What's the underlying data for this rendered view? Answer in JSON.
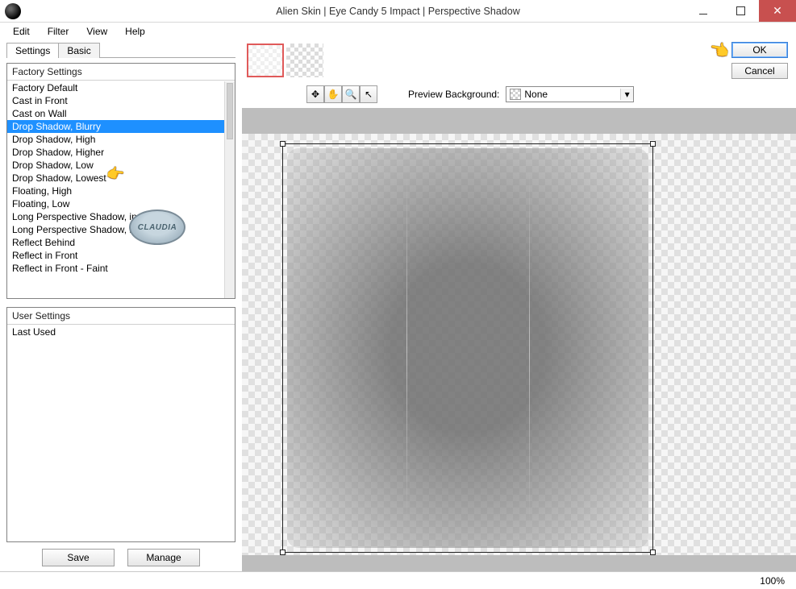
{
  "title": "Alien Skin | Eye Candy 5 Impact | Perspective Shadow",
  "menu": {
    "edit": "Edit",
    "filter": "Filter",
    "view": "View",
    "help": "Help"
  },
  "tabs": {
    "settings": "Settings",
    "basic": "Basic"
  },
  "factory": {
    "header": "Factory Settings",
    "items": [
      "Factory Default",
      "Cast in Front",
      "Cast on Wall",
      "Drop Shadow, Blurry",
      "Drop Shadow, High",
      "Drop Shadow, Higher",
      "Drop Shadow, Low",
      "Drop Shadow, Lowest",
      "Floating, High",
      "Floating, Low",
      "Long Perspective Shadow, in Back",
      "Long Perspective Shadow, in Front",
      "Reflect Behind",
      "Reflect in Front",
      "Reflect in Front - Faint"
    ],
    "selected_index": 3
  },
  "user": {
    "header": "User Settings",
    "items": [
      "Last Used"
    ]
  },
  "buttons": {
    "save": "Save",
    "manage": "Manage",
    "ok": "OK",
    "cancel": "Cancel"
  },
  "toolbar": {
    "preview_bg_label": "Preview Background:",
    "preview_bg_value": "None",
    "icons": {
      "move_sel": "move-selection",
      "hand": "hand-tool",
      "zoom": "zoom-tool",
      "pointer": "pointer-tool"
    }
  },
  "status": {
    "zoom": "100%"
  },
  "watermark": "CLAUDIA"
}
